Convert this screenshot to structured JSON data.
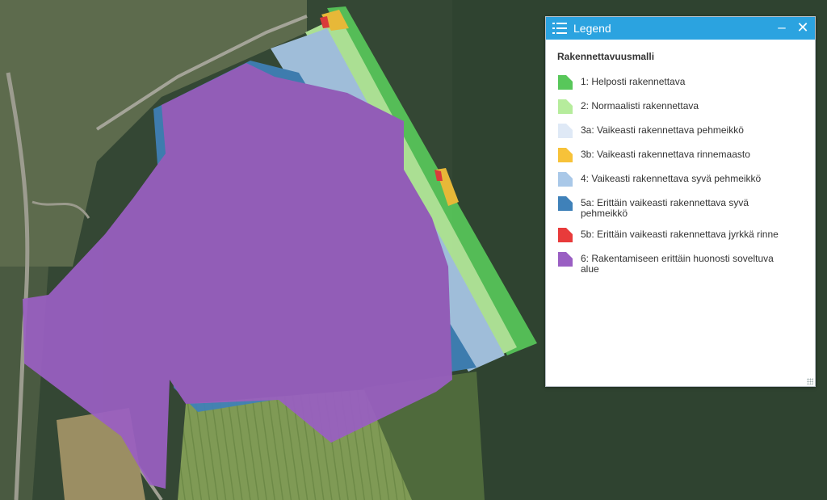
{
  "legend": {
    "title": "Legend",
    "minimize_label": "–",
    "close_label": "✕",
    "layer_title": "Rakennettavuusmalli",
    "items": [
      {
        "label": "1: Helposti rakennettava",
        "color": "#58c75a"
      },
      {
        "label": "2: Normaalisti rakennettava",
        "color": "#b6ec9c"
      },
      {
        "label": "3a: Vaikeasti rakennettava pehmeikkö",
        "color": "#dfe9f6"
      },
      {
        "label": "3b: Vaikeasti rakennettava rinnemaasto",
        "color": "#f7c239"
      },
      {
        "label": "4: Vaikeasti rakennettava syvä pehmeikkö",
        "color": "#a9c8e8"
      },
      {
        "label": "5a: Erittäin vaikeasti rakennettava syvä pehmeikkö",
        "color": "#3f81b9"
      },
      {
        "label": "5b: Erittäin vaikeasti rakennettava jyrkkä rinne",
        "color": "#e83b3b"
      },
      {
        "label": "6: Rakentamiseen erittäin huonosti soveltuva alue",
        "color": "#9a5fc3"
      }
    ]
  },
  "icons": {
    "legend": "list-icon",
    "minimize": "minimize-icon",
    "close": "close-icon",
    "resize": "resize-handle-icon"
  }
}
